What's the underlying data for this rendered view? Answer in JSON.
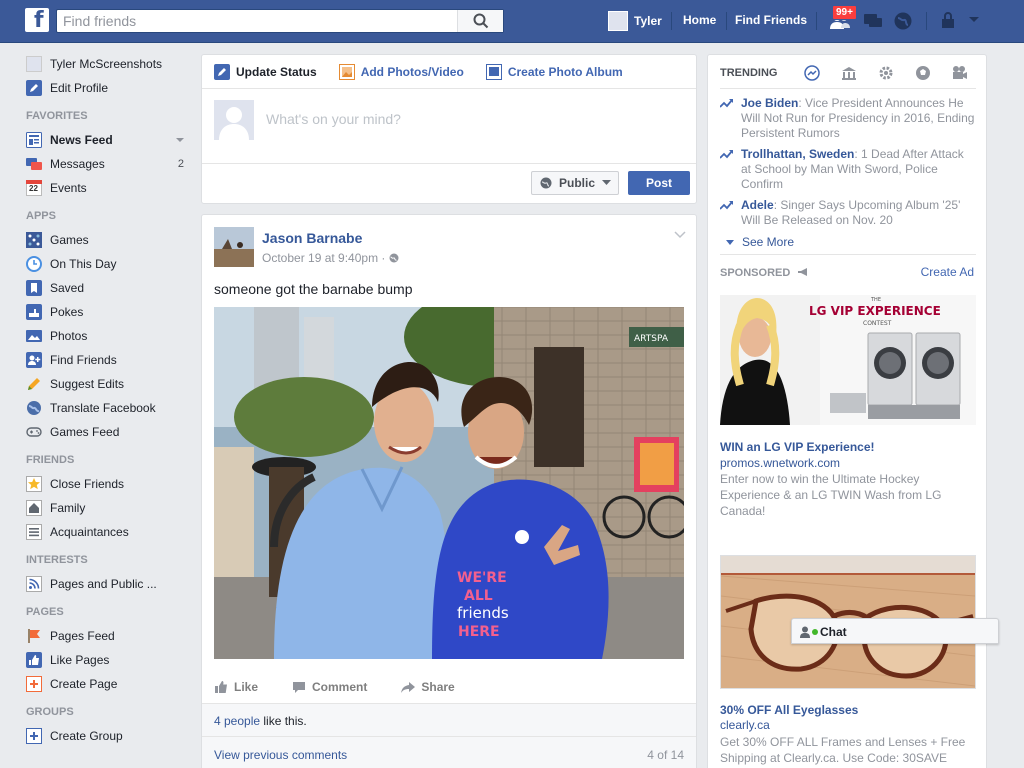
{
  "topbar": {
    "logo_icon": "facebook-logo",
    "search_placeholder": "Find friends",
    "user_name": "Tyler",
    "home_label": "Home",
    "find_friends_label": "Find Friends",
    "notification_badge": "99+",
    "brand_color": "#3b5998"
  },
  "left_nav": {
    "profile": {
      "name": "Tyler McScreenshots",
      "edit_label": "Edit Profile"
    },
    "favorites": {
      "heading": "FAVORITES",
      "items": [
        {
          "label": "News Feed",
          "icon": "news-feed-icon"
        },
        {
          "label": "Messages",
          "icon": "messages-icon",
          "count": "2"
        },
        {
          "label": "Events",
          "icon": "calendar-icon",
          "icon_text": "22"
        }
      ]
    },
    "apps": {
      "heading": "APPS",
      "items": [
        {
          "label": "Games",
          "icon": "games-icon"
        },
        {
          "label": "On This Day",
          "icon": "clock-icon"
        },
        {
          "label": "Saved",
          "icon": "bookmark-icon"
        },
        {
          "label": "Pokes",
          "icon": "poke-icon"
        },
        {
          "label": "Photos",
          "icon": "photos-icon"
        },
        {
          "label": "Find Friends",
          "icon": "find-friends-icon"
        },
        {
          "label": "Suggest Edits",
          "icon": "pencil-icon"
        },
        {
          "label": "Translate Facebook",
          "icon": "globe-icon"
        },
        {
          "label": "Games Feed",
          "icon": "gamepad-icon"
        }
      ]
    },
    "friends": {
      "heading": "FRIENDS",
      "items": [
        {
          "label": "Close Friends",
          "icon": "star-icon"
        },
        {
          "label": "Family",
          "icon": "house-icon"
        },
        {
          "label": "Acquaintances",
          "icon": "list-icon"
        }
      ]
    },
    "interests": {
      "heading": "INTERESTS",
      "items": [
        {
          "label": "Pages and Public ...",
          "icon": "rss-icon"
        }
      ]
    },
    "pages": {
      "heading": "PAGES",
      "items": [
        {
          "label": "Pages Feed",
          "icon": "flag-icon"
        },
        {
          "label": "Like Pages",
          "icon": "like-icon"
        },
        {
          "label": "Create Page",
          "icon": "plus-icon"
        }
      ]
    },
    "groups": {
      "heading": "GROUPS",
      "items": [
        {
          "label": "Create Group",
          "icon": "plus-icon"
        }
      ]
    }
  },
  "composer": {
    "tabs": [
      {
        "label": "Update Status",
        "icon": "pencil-icon"
      },
      {
        "label": "Add Photos/Video",
        "icon": "photo-icon"
      },
      {
        "label": "Create Photo Album",
        "icon": "album-icon"
      }
    ],
    "placeholder": "What's on your mind?",
    "privacy_label": "Public",
    "post_label": "Post"
  },
  "post": {
    "author": "Jason Barnabe",
    "timestamp": "October 19 at 9:40pm",
    "text": "someone got the barnabe bump",
    "actions": {
      "like": "Like",
      "comment": "Comment",
      "share": "Share"
    },
    "likes_link": "4 people",
    "likes_suffix": " like this.",
    "view_previous": "View previous comments",
    "comment_count": "4 of 14",
    "photo_signs": {
      "artspace": "ARTSPA",
      "shirt": [
        "WE'RE",
        "ALL",
        "friends",
        "HERE"
      ]
    }
  },
  "trending": {
    "heading": "TRENDING",
    "items": [
      {
        "topic": "Joe Biden",
        "text": ": Vice President Announces He Will Not Run for Presidency in 2016, Ending Persistent Rumors"
      },
      {
        "topic": "Trollhattan, Sweden",
        "text": ": 1 Dead After Attack at School by Man With Sword, Police Confirm"
      },
      {
        "topic": "Adele",
        "text": ": Singer Says Upcoming Album '25' Will Be Released on Nov. 20"
      }
    ],
    "see_more": "See More"
  },
  "sponsored": {
    "heading": "SPONSORED",
    "create_ad": "Create Ad",
    "ads": [
      {
        "image_text": {
          "small": "THE",
          "brand": "LG VIP EXPERIENCE",
          "sub": "CONTEST"
        },
        "title": "WIN an LG VIP Experience!",
        "domain": "promos.wnetwork.com",
        "desc": "Enter now to win the Ultimate Hockey Experience & an LG TWIN Wash from LG Canada!"
      },
      {
        "title": "30% OFF All Eyeglasses",
        "domain": "clearly.ca",
        "desc": "Get 30% OFF ALL Frames and Lenses + Free Shipping at Clearly.ca. Use Code: 30SAVE"
      }
    ]
  },
  "chat": {
    "label": "Chat"
  }
}
